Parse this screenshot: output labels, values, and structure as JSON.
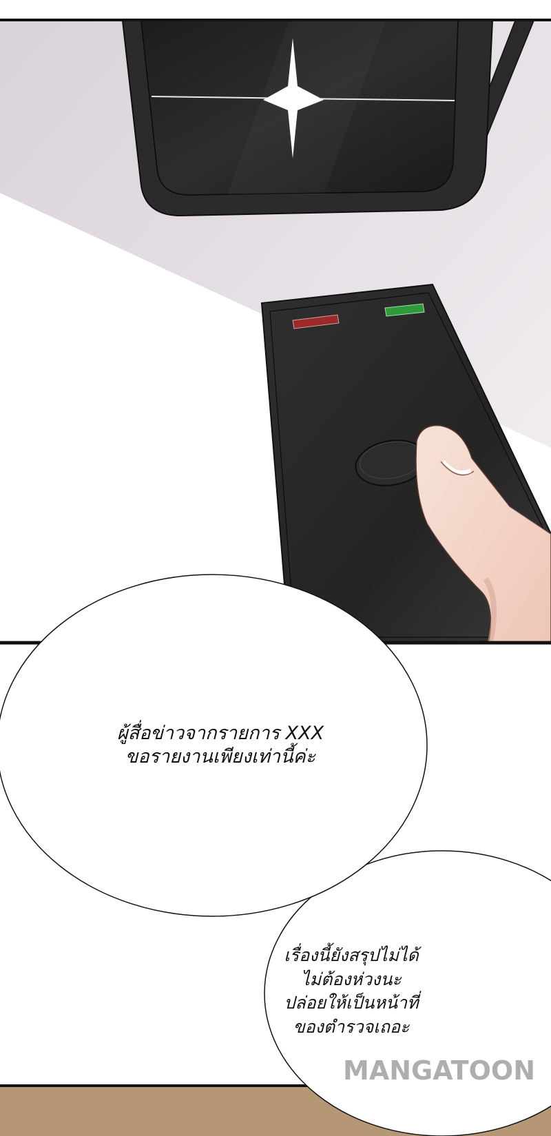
{
  "panels": [
    {
      "id": "panel-monitor-remote",
      "description_color_bg": "#ece8ec"
    },
    {
      "id": "panel-dialogue"
    }
  ],
  "bubbles": [
    {
      "lines": [
        "ผู้สื่อข่าวจากรายการ XXX",
        "ขอรายงานเพียงเท่านี้ค่ะ"
      ]
    },
    {
      "lines": [
        "เรื่องนี้ยังสรุปไม่ได้",
        "ไม่ต้องห่วงนะ",
        "ปล่อยให้เป็นหน้าที่",
        "ของตำรวจเถอะ"
      ]
    }
  ],
  "watermark": {
    "text": "MANGATOON"
  },
  "colors": {
    "device_body": "#2a2a2a",
    "red_led": "#9b2b2b",
    "green_led": "#2f9a3c",
    "finger_skin": "#f3d8cc",
    "floor": "#b59776"
  },
  "icons": {
    "sparkle": "sparkle-icon"
  }
}
